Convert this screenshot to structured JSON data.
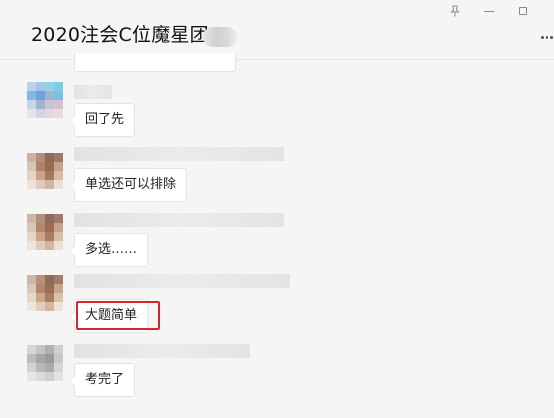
{
  "window": {
    "title": "2020注会C位魔星团",
    "controls": {
      "pin": "pin-icon",
      "minimize": "minimize-icon",
      "maximize": "maximize-icon",
      "more": "more-icon"
    }
  },
  "messages": [
    {
      "text": "回了先"
    },
    {
      "text": "单选还可以排除"
    },
    {
      "text": "多选……"
    },
    {
      "text": "大题简单",
      "highlighted": true
    },
    {
      "text": "考完了"
    }
  ],
  "colors": {
    "background": "#f5f5f5",
    "bubble": "#ffffff",
    "highlight": "#d2272b"
  }
}
